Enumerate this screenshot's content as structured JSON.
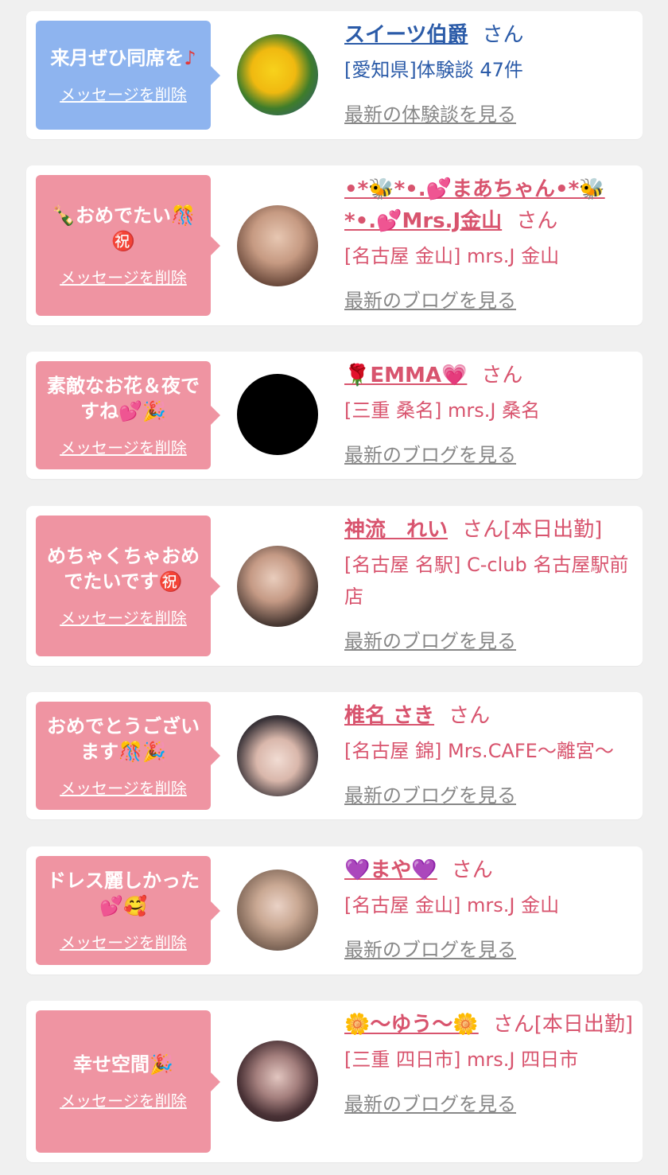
{
  "colors": {
    "blue_bubble": "#8eb4ef",
    "pink_bubble": "#ef94a2",
    "blue_text": "#2b5ba8",
    "pink_text": "#d8546e",
    "link_gray": "#888888"
  },
  "delete_label": "メッセージを削除",
  "san_label": "さん",
  "cards": [
    {
      "message": "来月ぜひ同席を",
      "message_icon": "music-note-icon",
      "name": "スイーツ伯爵",
      "san_suffix": "",
      "desc": "[愛知県]体験談 47件",
      "latest": "最新の体験談を見る",
      "theme": "blue",
      "avatar": "yellow-hibiscus-flower"
    },
    {
      "message": "🍾おめでたい🎊㊗️",
      "name": "•*🐝*•.💕まあちゃん•*🐝*•.💕Mrs.J金山",
      "san_suffix": "",
      "desc": "[名古屋 金山] mrs.J 金山",
      "latest": "最新のブログを見る",
      "theme": "pink",
      "avatar": "woman-portrait"
    },
    {
      "message": "素敵なお花＆夜ですね💕🎉",
      "name": "🌹EMMA💗",
      "san_suffix": "",
      "desc": "[三重 桑名] mrs.J 桑名",
      "latest": "最新のブログを見る",
      "theme": "pink",
      "avatar": "black-text-image"
    },
    {
      "message": "めちゃくちゃおめでたいです㊗️",
      "name": "神流　れい",
      "san_suffix": "[本日出勤]",
      "desc": "[名古屋 名駅] C-club 名古屋駅前店",
      "latest": "最新のブログを見る",
      "theme": "pink",
      "avatar": "woman-portrait"
    },
    {
      "message": "おめでとうございます🎊🎉",
      "name": "椎名 さき",
      "san_suffix": "",
      "desc": "[名古屋 錦] Mrs.CAFE〜離宮〜",
      "latest": "最新のブログを見る",
      "theme": "pink",
      "avatar": "woman-portrait"
    },
    {
      "message": "ドレス麗しかった💕🥰",
      "name": "💜まや💜",
      "san_suffix": "",
      "desc": "[名古屋 金山] mrs.J 金山",
      "latest": "最新のブログを見る",
      "theme": "pink",
      "avatar": "woman-portrait"
    },
    {
      "message": "幸せ空間🎉",
      "name": "🌼〜ゆう〜🌼",
      "san_suffix": "[本日出勤]",
      "desc": "[三重 四日市] mrs.J 四日市",
      "latest": "最新のブログを見る",
      "theme": "pink",
      "avatar": "woman-portrait"
    }
  ]
}
